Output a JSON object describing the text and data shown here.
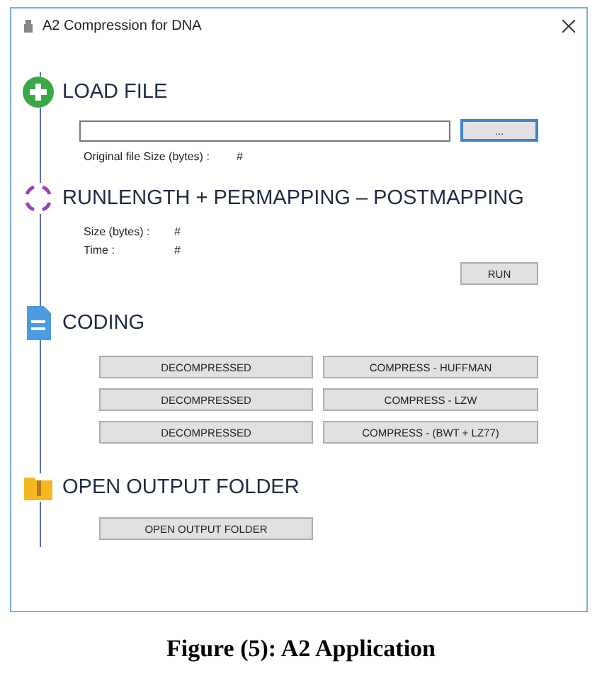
{
  "window": {
    "title": "A2 Compression for DNA"
  },
  "sections": [
    {
      "kind": "load",
      "heading": "LOAD FILE",
      "browse_button": "...",
      "info": [
        {
          "label": "Original file Size (bytes) :",
          "value": "#"
        }
      ]
    },
    {
      "kind": "process",
      "heading": "RUNLENGTH + PERMAPPING – POSTMAPPING",
      "info": [
        {
          "label": "Size (bytes) :",
          "value": "#"
        },
        {
          "label": "Time :",
          "value": "#"
        }
      ],
      "run_button": "RUN"
    },
    {
      "kind": "coding",
      "heading": "CODING",
      "button_rows": [
        [
          "DECOMPRESSED",
          "COMPRESS - HUFFMAN"
        ],
        [
          "DECOMPRESSED",
          "COMPRESS - LZW"
        ],
        [
          "DECOMPRESSED",
          "COMPRESS - (BWT + LZ77)"
        ]
      ]
    },
    {
      "kind": "folder",
      "heading": "OPEN OUTPUT FOLDER",
      "folder_button": "OPEN OUTPUT FOLDER"
    }
  ],
  "caption": "Figure (5): A2 Application"
}
